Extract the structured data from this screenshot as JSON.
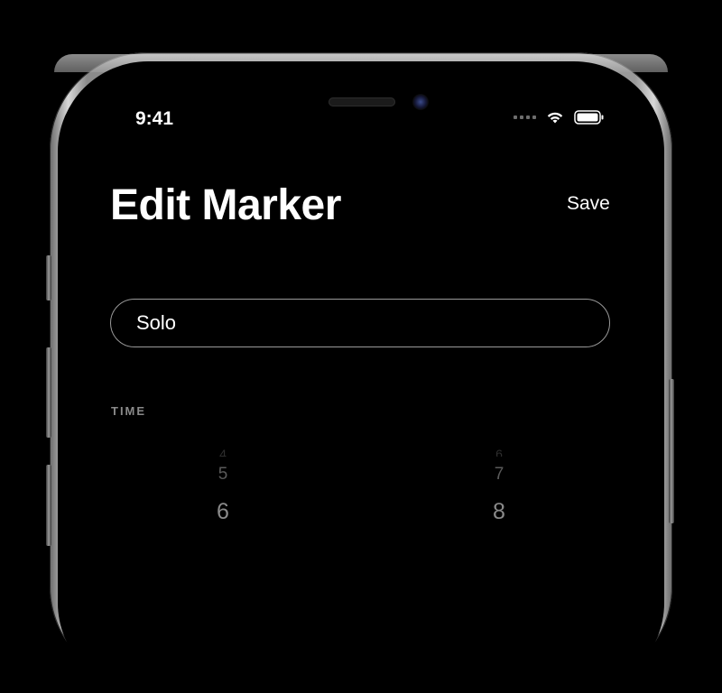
{
  "status_bar": {
    "time": "9:41"
  },
  "header": {
    "title": "Edit Marker",
    "save_label": "Save"
  },
  "marker_name_field": {
    "value": "Solo"
  },
  "time_section": {
    "label": "TIME",
    "left_column": [
      "4",
      "5",
      "6"
    ],
    "right_column": [
      "6",
      "7",
      "8"
    ]
  },
  "icons": {
    "signal": "cellular-signal-icon",
    "wifi": "wifi-icon",
    "battery": "battery-icon"
  }
}
